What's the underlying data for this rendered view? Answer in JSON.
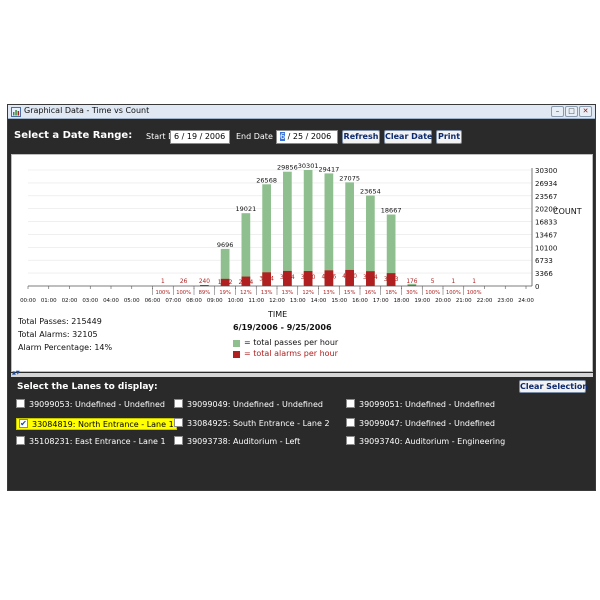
{
  "window": {
    "title": "Graphical Data - Time vs Count",
    "buttons": {
      "minimize": "–",
      "maximize": "□",
      "close": "✕"
    }
  },
  "toolbar": {
    "select_label": "Select a Date Range:",
    "start_label": "Start Date",
    "start_value": {
      "pre": "6  / 19 / 2006",
      "sel": ""
    },
    "end_label": "End Date",
    "end_value": {
      "sel": "6",
      "post": "  / 25 / 2006"
    },
    "refresh_label": "Refresh",
    "clear_date_label": "Clear Date",
    "print_label": "Print"
  },
  "colors": {
    "passes": "#8fbf8f",
    "alarms": "#b02020",
    "accent": "#3b74d6",
    "highlight": "#ffff00"
  },
  "stats": {
    "total_passes": "Total Passes: 215449",
    "total_alarms": "Total Alarms: 32105",
    "alarm_percentage": "Alarm Percentage: 14%"
  },
  "chart_data": {
    "type": "bar",
    "xlabel": "TIME",
    "ylabel": "COUNT",
    "subtitle": "6/19/2006 - 9/25/2006",
    "ylim": [
      0,
      30300
    ],
    "y_ticks": [
      "30300",
      "26934",
      "23567",
      "20200",
      "16833",
      "13467",
      "10100",
      "6733",
      "3366",
      "0"
    ],
    "x_ticks": [
      "00:00",
      "01:00",
      "02:00",
      "03:00",
      "04:00",
      "05:00",
      "06:00",
      "07:00",
      "08:00",
      "09:00",
      "10:00",
      "11:00",
      "12:00",
      "13:00",
      "14:00",
      "15:00",
      "16:00",
      "17:00",
      "18:00",
      "19:00",
      "20:00",
      "21:00",
      "22:00",
      "23:00",
      "24:00"
    ],
    "categories": [
      "00",
      "01",
      "02",
      "03",
      "04",
      "05",
      "06",
      "07",
      "08",
      "09",
      "10",
      "11",
      "12",
      "13",
      "14",
      "15",
      "16",
      "17",
      "18",
      "19",
      "20",
      "21",
      "22",
      "23"
    ],
    "series": [
      {
        "name": "total passes per hour",
        "values": [
          0,
          0,
          0,
          0,
          0,
          0,
          1,
          26,
          270,
          9696,
          19021,
          26568,
          29856,
          30301,
          29417,
          27075,
          23654,
          18667,
          576,
          5,
          1,
          1,
          0,
          0
        ],
        "labels": [
          "",
          "",
          "",
          "",
          "",
          "",
          "",
          "",
          "",
          "9696",
          "19021",
          "26568",
          "29856",
          "30301",
          "29417",
          "27075",
          "23654",
          "18667",
          "",
          "",
          "",
          "",
          "",
          ""
        ]
      },
      {
        "name": "total alarms per hour",
        "values": [
          0,
          0,
          0,
          0,
          0,
          0,
          1,
          26,
          240,
          1872,
          2464,
          3574,
          3934,
          3910,
          4086,
          4190,
          3864,
          3363,
          176,
          5,
          1,
          1,
          0,
          0
        ],
        "labels": [
          "",
          "",
          "",
          "",
          "",
          "",
          "1",
          "26",
          "240",
          "1872",
          "2464",
          "3574",
          "3934",
          "3910",
          "4086",
          "4190",
          "3864",
          "3363",
          "176",
          "5",
          "1",
          "1",
          "",
          ""
        ]
      }
    ],
    "percent_row": [
      "",
      "",
      "",
      "",
      "",
      "",
      "100%",
      "100%",
      "89%",
      "19%",
      "12%",
      "13%",
      "13%",
      "12%",
      "13%",
      "15%",
      "16%",
      "18%",
      "30%",
      "100%",
      "100%",
      "100%",
      "",
      ""
    ],
    "legend": [
      "= total passes per hour",
      "= total alarms per hour"
    ]
  },
  "lanes": {
    "title": "Select the Lanes to display:",
    "clear_label": "Clear Selection",
    "items": [
      {
        "label": "39099053: Undefined - Undefined",
        "checked": false
      },
      {
        "label": "39099049: Undefined - Undefined",
        "checked": false
      },
      {
        "label": "39099051: Undefined - Undefined",
        "checked": false
      },
      {
        "label": "33084819: North Entrance - Lane 1",
        "checked": true
      },
      {
        "label": "33084925: South Entrance - Lane 2",
        "checked": false
      },
      {
        "label": "39099047: Undefined - Undefined",
        "checked": false
      },
      {
        "label": "35108231: East Entrance - Lane 1",
        "checked": false
      },
      {
        "label": "39093738: Auditorium -   Left",
        "checked": false
      },
      {
        "label": "39093740: Auditorium -   Engineering",
        "checked": false
      }
    ]
  }
}
